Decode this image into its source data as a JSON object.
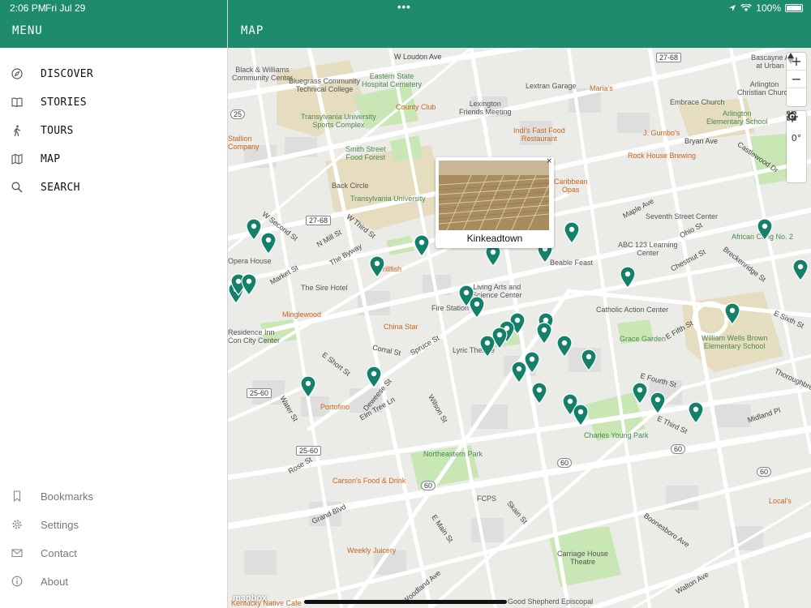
{
  "status_bar": {
    "time": "2:06 PM",
    "date": "Fri Jul 29",
    "battery": "100%"
  },
  "menu_header": {
    "title": "MENU"
  },
  "map_header": {
    "title": "MAP"
  },
  "nav": [
    {
      "label": "DISCOVER",
      "icon": "compass-icon"
    },
    {
      "label": "STORIES",
      "icon": "book-icon"
    },
    {
      "label": "TOURS",
      "icon": "walking-icon"
    },
    {
      "label": "MAP",
      "icon": "map-icon"
    },
    {
      "label": "SEARCH",
      "icon": "search-icon"
    }
  ],
  "footer_nav": [
    {
      "label": "Bookmarks",
      "icon": "bookmark-icon"
    },
    {
      "label": "Settings",
      "icon": "gear-icon"
    },
    {
      "label": "Contact",
      "icon": "mail-icon"
    },
    {
      "label": "About",
      "icon": "info-icon"
    }
  ],
  "popup": {
    "title": "Kinkeadtown",
    "close": "×"
  },
  "controls": {
    "zoom_in": "+",
    "zoom_out": "−",
    "compass": "0°"
  },
  "attribution": "mapbox",
  "colors": {
    "brand": "#1e8c6c",
    "pin": "#14806a"
  },
  "map_labels": {
    "loudon": "W Loudon Ave",
    "black_williams": "Black & Williams\nCommunity Center",
    "bluegrass": "Bluegrass Community\nTechnical College",
    "eastern_state": "Eastern State\nHospital Cemetery",
    "county_club": "County Club",
    "lexington_friends": "Lexington\nFriends Meeting",
    "lextran": "Lextran Garage",
    "marias": "Maria's",
    "embrace": "Embrace Church",
    "arlington_elem": "Arlington\nElementary School",
    "arlington_church": "Arlington\nChristian Church",
    "bascayne": "Bascayne Apt\nat Urban F",
    "transylvania_sports": "Transylvania University\nSports Complex",
    "indis": "Indi's Fast Food\nRestaurant",
    "jgumbos": "J. Gumbo's",
    "stallion": "Stallion\nCompany",
    "smith_street": "Smith Street\nFood Forest",
    "rock_house": "Rock House Brewing",
    "bryan_ave": "Bryan Ave",
    "back_circle": "Back Circle",
    "transylvania": "Transylvania University",
    "caribbean": "Caribbean\nOpas",
    "seventh_center": "Seventh Street Center",
    "african_cong": "African Cong No. 2",
    "opera_house": "Opera House",
    "grillfish": "Grillfish",
    "abc123": "ABC 123 Learning\nCenter",
    "beable": "Beable Feast",
    "living_arts": "Living Arts and\nScience Center",
    "sire_hotel": "The Sire Hotel",
    "minglewood": "Minglewood",
    "fire_station": "Fire Station",
    "catholic_action": "Catholic Action Center",
    "china_star": "China Star",
    "residence_inn": "Residence Inn\nCon City Center",
    "lyric": "Lyric Theatre",
    "grace_garden": "Grace Garden",
    "william_wells": "William Wells Brown\nElementary School",
    "portofino": "Portofino",
    "charles_young": "Charles Young Park",
    "northeastern": "Northeastern Park",
    "carsons": "Carson's Food & Drink",
    "fcps": "FCPS",
    "locals": "Local's",
    "weekly_juicery": "Weekly Juicery",
    "carriage_house": "Carriage House\nTheatre",
    "kentucky_native": "Kentucky Native Cafe",
    "good_shepherd": "Good Shepherd Episcopal",
    "w_second": "W Second St",
    "w_third": "W Third St",
    "n_mill": "N Mill St",
    "market": "Market St",
    "the_byway": "The Byway",
    "e_short": "E Short St",
    "elm_tree": "Elm Tree Ln",
    "corral": "Corral St",
    "spruce": "Spruce St",
    "wilson": "Wilson St",
    "e_third": "E Third St",
    "e_fourth": "E Fourth St",
    "e_fifth": "E Fifth St",
    "e_sixth": "E Sixth St",
    "midland": "Midland Pl",
    "walton": "Walton Ave",
    "rose": "Rose St",
    "grand": "Grand Blvd",
    "e_main": "E Main St",
    "woodland": "Woodland Ave",
    "skain": "Skain St",
    "booneboro": "Boonesboro Ave",
    "maple": "Maple Ave",
    "chestnut": "Chestnut St",
    "breckenridge": "Breckenridge St",
    "ohio": "Ohio St",
    "castlewood": "Castlewood Dr",
    "thoroughbred": "Thoroughbred",
    "dewees": "Deweese St",
    "water": "Water St",
    "r27_68": "27-68",
    "r25_60": "25-60",
    "r25_60b": "25-60",
    "r60": "60",
    "r60b": "60",
    "r60c": "60",
    "r60d": "60",
    "r25": "25",
    "r27_68b": "27-68"
  }
}
